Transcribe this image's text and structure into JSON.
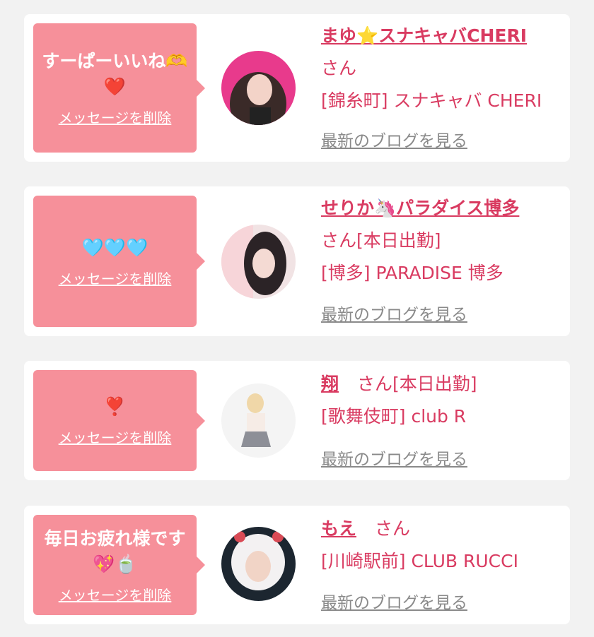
{
  "messages": [
    {
      "text": "すーぱーいいね🫶\n❤️",
      "delete_label": "メッセージを削除",
      "name": "まゆ⭐️スナキャバCHERI",
      "suffix": "さん",
      "shop": "[錦糸町] スナキャバ CHERI",
      "blog_label": "最新のブログを見る"
    },
    {
      "text": "🩵🩵🩵",
      "delete_label": "メッセージを削除",
      "name": "せりか🦄パラダイス博多",
      "suffix": "さん[本日出勤]",
      "shop": "[博多] PARADISE 博多",
      "blog_label": "最新のブログを見る"
    },
    {
      "text": "❣️",
      "delete_label": "メッセージを削除",
      "name": "翔",
      "suffix": "さん[本日出勤]",
      "shop": "[歌舞伎町] club R",
      "blog_label": "最新のブログを見る"
    },
    {
      "text": "毎日お疲れ様です\n💖🍵",
      "delete_label": "メッセージを削除",
      "name": "もえ",
      "suffix": "さん",
      "shop": "[川崎駅前] CLUB RUCCI",
      "blog_label": "最新のブログを見る"
    }
  ],
  "colors": {
    "bubble": "#f6909a",
    "accent": "#d93b61",
    "link_gray": "#8a8a8a",
    "background": "#f2f2f2"
  }
}
